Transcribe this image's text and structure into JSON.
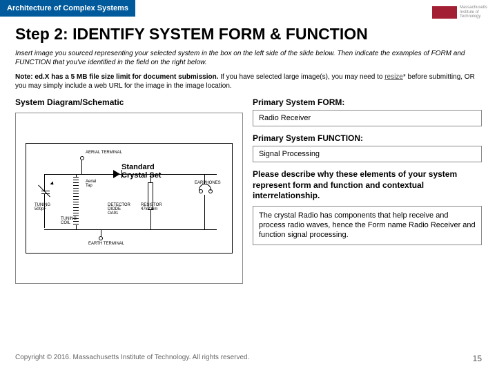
{
  "header": {
    "course": "Architecture of Complex Systems"
  },
  "logo": {
    "institution": "Massachusetts\nInstitute of\nTechnology"
  },
  "title": "Step 2: IDENTIFY SYSTEM FORM & FUNCTION",
  "instructions": "Insert image you sourced representing your selected system in the box on the left side of the slide below. Then indicate the examples of FORM and FUNCTION that you've identified in the field on the right below.",
  "note": {
    "bold": "Note: ed.X has a 5 MB file size limit for document submission.",
    "rest1": " If you have selected large image(s), you may need to ",
    "resize": "resize",
    "rest2": "* before submitting, OR you may simply include a web URL for the image in the image location."
  },
  "left": {
    "label": "System Diagram/Schematic"
  },
  "diagram": {
    "title": "Standard\nCrystal Set",
    "labels": {
      "aerial_terminal": "AERIAL TERMINAL",
      "aerial_tap": "Aerial\nTap",
      "tuning": "TUNING\n500pF",
      "tuning_coil": "TUNING\nCOIL",
      "detector": "DETECTOR\nDIODE\nOA91",
      "resistor": "RESISTOR\n47k Ohm",
      "earphones": "EARPHONES",
      "earth_terminal": "EARTH TERMINAL"
    }
  },
  "right": {
    "form_label": "Primary System FORM:",
    "form_value": "Radio Receiver",
    "function_label": "Primary System FUNCTION:",
    "function_value": "Signal Processing",
    "desc_label": "Please describe why these elements of your system represent form and function and contextual interrelationship.",
    "desc_value": "The crystal Radio has components that help receive and process radio waves, hence the Form name Radio Receiver and function signal processing."
  },
  "footer": {
    "copyright": "Copyright © 2016. Massachusetts Institute of Technology. All rights reserved.",
    "page": "15"
  }
}
